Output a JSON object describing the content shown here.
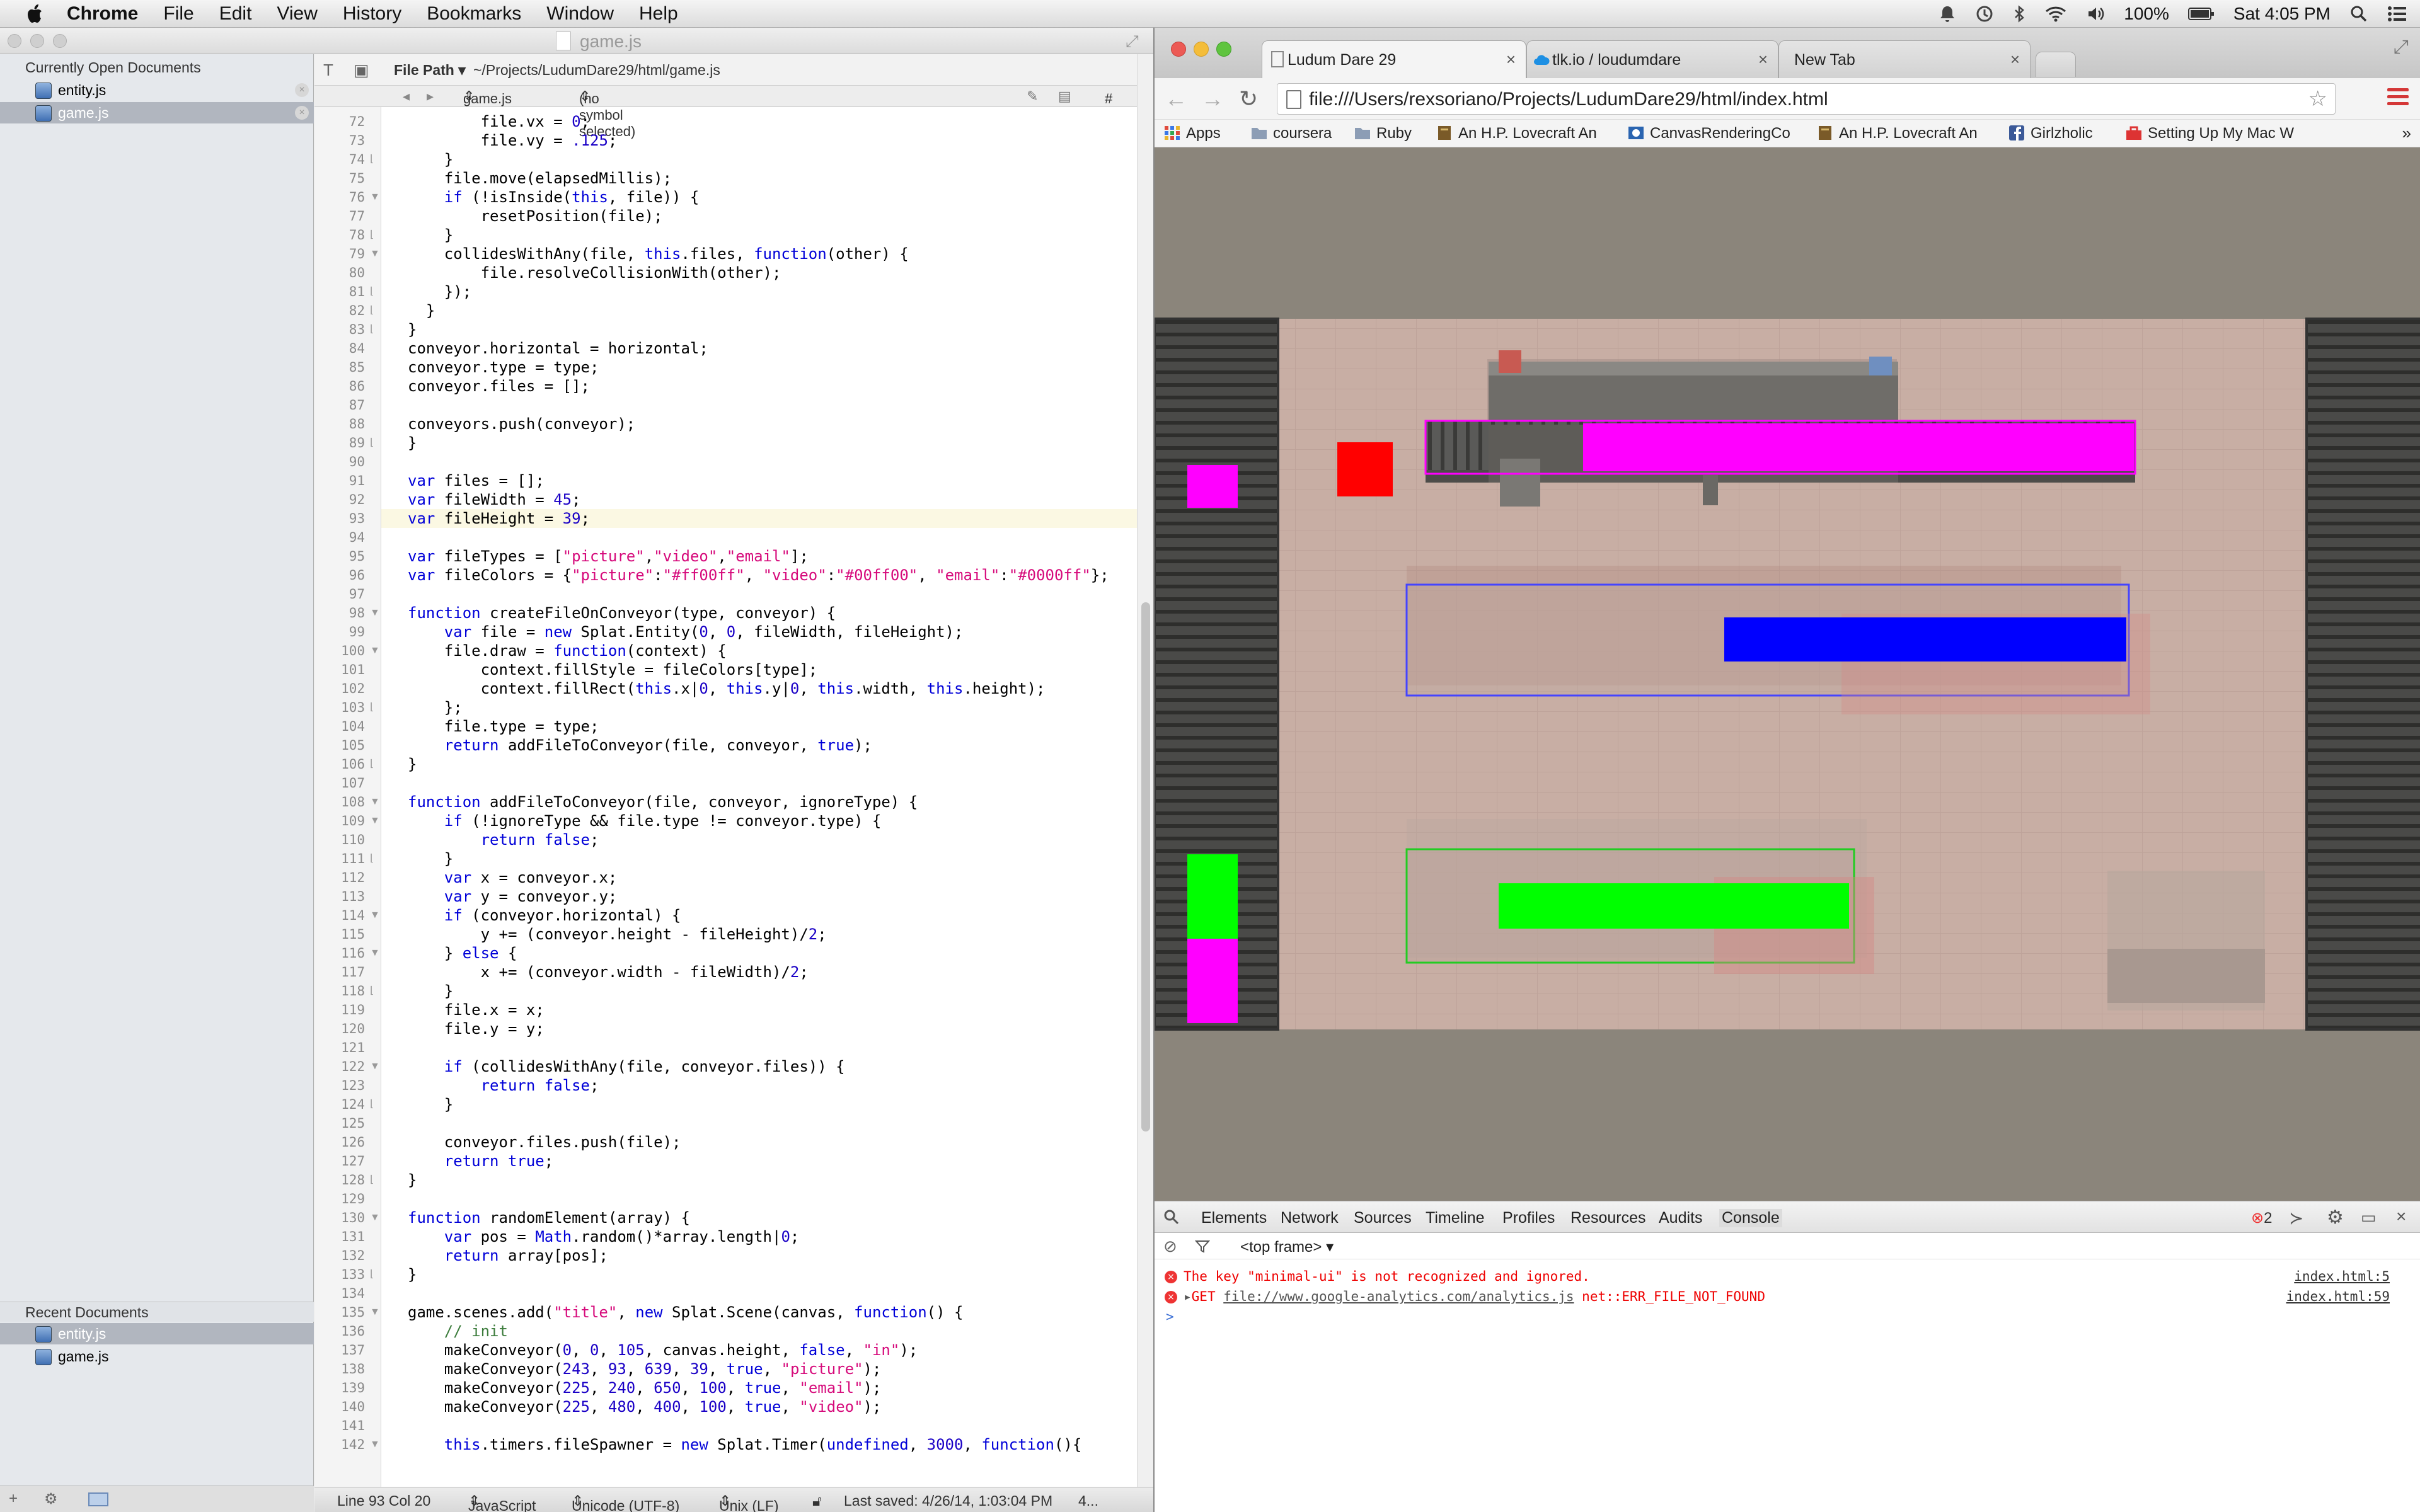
{
  "menubar": {
    "app_name": "Chrome",
    "menus": [
      "File",
      "Edit",
      "View",
      "History",
      "Bookmarks",
      "Window",
      "Help"
    ],
    "battery": "100%",
    "clock": "Sat 4:05 PM"
  },
  "editor": {
    "window_title": "game.js",
    "sidebar": {
      "open_header": "Currently Open Documents",
      "open_docs": [
        "entity.js",
        "game.js"
      ],
      "recent_header": "Recent Documents",
      "recent_docs": [
        "entity.js",
        "game.js"
      ]
    },
    "path_label": "File Path",
    "path_value": "~/Projects/LudumDare29/html/game.js",
    "jump_file": "game.js",
    "jump_symbol": "(no symbol selected)",
    "jump_hash": "#",
    "lines": [
      {
        "n": "72",
        "f": "",
        "h": "        file.vx = <n>0</n>;"
      },
      {
        "n": "73",
        "f": "",
        "h": "        file.vy = <n>.125</n>;"
      },
      {
        "n": "74",
        "f": "-",
        "h": "    }"
      },
      {
        "n": "75",
        "f": "",
        "h": "    file.move(elapsedMillis);"
      },
      {
        "n": "76",
        "f": "v",
        "h": "    <k>if</k> (!isInside(<k>this</k>, file)) {"
      },
      {
        "n": "77",
        "f": "",
        "h": "        resetPosition(file);"
      },
      {
        "n": "78",
        "f": "-",
        "h": "    }"
      },
      {
        "n": "79",
        "f": "v",
        "h": "    collidesWithAny(file, <k>this</k>.files, <k>function</k>(other) {"
      },
      {
        "n": "80",
        "f": "",
        "h": "        file.resolveCollisionWith(other);"
      },
      {
        "n": "81",
        "f": "-",
        "h": "    });"
      },
      {
        "n": "82",
        "f": "-",
        "h": "  }"
      },
      {
        "n": "83",
        "f": "-",
        "h": "}"
      },
      {
        "n": "84",
        "f": "",
        "h": "conveyor.horizontal = horizontal;"
      },
      {
        "n": "85",
        "f": "",
        "h": "conveyor.type = type;"
      },
      {
        "n": "86",
        "f": "",
        "h": "conveyor.files = [];"
      },
      {
        "n": "87",
        "f": "",
        "h": ""
      },
      {
        "n": "88",
        "f": "",
        "h": "conveyors.push(conveyor);"
      },
      {
        "n": "89",
        "f": "-",
        "h": "}"
      },
      {
        "n": "90",
        "f": "",
        "h": ""
      },
      {
        "n": "91",
        "f": "",
        "h": "<k>var</k> files = [];"
      },
      {
        "n": "92",
        "f": "",
        "h": "<k>var</k> fileWidth = <n>45</n>;"
      },
      {
        "n": "93",
        "f": "",
        "h": "<k>var</k> fileHeight = <n>39</n>;"
      },
      {
        "n": "94",
        "f": "",
        "h": ""
      },
      {
        "n": "95",
        "f": "",
        "h": "<k>var</k> fileTypes = [<s>\"picture\"</s>,<s>\"video\"</s>,<s>\"email\"</s>];"
      },
      {
        "n": "96",
        "f": "",
        "h": "<k>var</k> fileColors = {<s>\"picture\"</s>:<s>\"#ff00ff\"</s>, <s>\"video\"</s>:<s>\"#00ff00\"</s>, <s>\"email\"</s>:<s>\"#0000ff\"</s>};"
      },
      {
        "n": "97",
        "f": "",
        "h": ""
      },
      {
        "n": "98",
        "f": "v",
        "h": "<k>function</k> createFileOnConveyor(type, conveyor) {"
      },
      {
        "n": "99",
        "f": "",
        "h": "    <k>var</k> file = <k>new</k> Splat.Entity(<n>0</n>, <n>0</n>, fileWidth, fileHeight);"
      },
      {
        "n": "100",
        "f": "v",
        "h": "    file.draw = <k>function</k>(context) {"
      },
      {
        "n": "101",
        "f": "",
        "h": "        context.fillStyle = fileColors[type];"
      },
      {
        "n": "102",
        "f": "",
        "h": "        context.fillRect(<k>this</k>.x|<n>0</n>, <k>this</k>.y|<n>0</n>, <k>this</k>.width, <k>this</k>.height);"
      },
      {
        "n": "103",
        "f": "-",
        "h": "    };"
      },
      {
        "n": "104",
        "f": "",
        "h": "    file.type = type;"
      },
      {
        "n": "105",
        "f": "",
        "h": "    <k>return</k> addFileToConveyor(file, conveyor, <k>true</k>);"
      },
      {
        "n": "106",
        "f": "-",
        "h": "}"
      },
      {
        "n": "107",
        "f": "",
        "h": ""
      },
      {
        "n": "108",
        "f": "v",
        "h": "<k>function</k> addFileToConveyor(file, conveyor, ignoreType) {"
      },
      {
        "n": "109",
        "f": "v",
        "h": "    <k>if</k> (!ignoreType && file.type != conveyor.type) {"
      },
      {
        "n": "110",
        "f": "",
        "h": "        <k>return</k> <k>false</k>;"
      },
      {
        "n": "111",
        "f": "-",
        "h": "    }"
      },
      {
        "n": "112",
        "f": "",
        "h": "    <k>var</k> x = conveyor.x;"
      },
      {
        "n": "113",
        "f": "",
        "h": "    <k>var</k> y = conveyor.y;"
      },
      {
        "n": "114",
        "f": "v",
        "h": "    <k>if</k> (conveyor.horizontal) {"
      },
      {
        "n": "115",
        "f": "",
        "h": "        y += (conveyor.height - fileHeight)/<n>2</n>;"
      },
      {
        "n": "116",
        "f": "v",
        "h": "    } <k>else</k> {"
      },
      {
        "n": "117",
        "f": "",
        "h": "        x += (conveyor.width - fileWidth)/<n>2</n>;"
      },
      {
        "n": "118",
        "f": "-",
        "h": "    }"
      },
      {
        "n": "119",
        "f": "",
        "h": "    file.x = x;"
      },
      {
        "n": "120",
        "f": "",
        "h": "    file.y = y;"
      },
      {
        "n": "121",
        "f": "",
        "h": ""
      },
      {
        "n": "122",
        "f": "v",
        "h": "    <k>if</k> (collidesWithAny(file, conveyor.files)) {"
      },
      {
        "n": "123",
        "f": "",
        "h": "        <k>return</k> <k>false</k>;"
      },
      {
        "n": "124",
        "f": "-",
        "h": "    }"
      },
      {
        "n": "125",
        "f": "",
        "h": ""
      },
      {
        "n": "126",
        "f": "",
        "h": "    conveyor.files.push(file);"
      },
      {
        "n": "127",
        "f": "",
        "h": "    <k>return</k> <k>true</k>;"
      },
      {
        "n": "128",
        "f": "-",
        "h": "}"
      },
      {
        "n": "129",
        "f": "",
        "h": ""
      },
      {
        "n": "130",
        "f": "v",
        "h": "<k>function</k> randomElement(array) {"
      },
      {
        "n": "131",
        "f": "",
        "h": "    <k>var</k> pos = <k>Math</k>.random()*array.length|<n>0</n>;"
      },
      {
        "n": "132",
        "f": "",
        "h": "    <k>return</k> array[pos];"
      },
      {
        "n": "133",
        "f": "-",
        "h": "}"
      },
      {
        "n": "134",
        "f": "",
        "h": ""
      },
      {
        "n": "135",
        "f": "v",
        "h": "game.scenes.add(<s>\"title\"</s>, <k>new</k> Splat.Scene(canvas, <k>function</k>() {"
      },
      {
        "n": "136",
        "f": "",
        "h": "    <c>// init</c>"
      },
      {
        "n": "137",
        "f": "",
        "h": "    makeConveyor(<n>0</n>, <n>0</n>, <n>105</n>, canvas.height, <k>false</k>, <s>\"in\"</s>);"
      },
      {
        "n": "138",
        "f": "",
        "h": "    makeConveyor(<n>243</n>, <n>93</n>, <n>639</n>, <n>39</n>, <k>true</k>, <s>\"picture\"</s>);"
      },
      {
        "n": "139",
        "f": "",
        "h": "    makeConveyor(<n>225</n>, <n>240</n>, <n>650</n>, <n>100</n>, <k>true</k>, <s>\"email\"</s>);"
      },
      {
        "n": "140",
        "f": "",
        "h": "    makeConveyor(<n>225</n>, <n>480</n>, <n>400</n>, <n>100</n>, <k>true</k>, <s>\"video\"</s>);"
      },
      {
        "n": "141",
        "f": "",
        "h": ""
      },
      {
        "n": "142",
        "f": "v",
        "h": "    <k>this</k>.timers.fileSpawner = <k>new</k> Splat.Timer(<k>undefined</k>, <n>3000</n>, <k>function</k>(){"
      }
    ],
    "highlight_line": "93",
    "status": {
      "position": "Line 93 Col 20",
      "language": "JavaScript",
      "encoding": "Unicode (UTF-8)",
      "line_endings": "Unix (LF)",
      "saved": "Last saved: 4/26/14, 1:03:04 PM",
      "extra": "4..."
    }
  },
  "browser": {
    "tabs": [
      {
        "label": "Ludum Dare 29",
        "active": true
      },
      {
        "label": "tlk.io / loudumdare",
        "active": false
      },
      {
        "label": "New Tab",
        "active": false
      }
    ],
    "url": "file:///Users/rexsoriano/Projects/LudumDare29/html/index.html",
    "bookmarks": [
      "Apps",
      "coursera",
      "Ruby",
      "An H.P. Lovecraft An",
      "CanvasRenderingCo",
      "An H.P. Lovecraft An",
      "Girlzholic",
      "Setting Up My Mac W"
    ],
    "game_colors": {
      "picture": "#ff00ff",
      "video": "#00ff00",
      "email": "#0000ff",
      "red": "#ff0000",
      "floor": "#c9afa5",
      "wall": "#8a847a"
    },
    "devtools": {
      "tabs": [
        "Elements",
        "Network",
        "Sources",
        "Timeline",
        "Profiles",
        "Resources",
        "Audits",
        "Console"
      ],
      "active_tab": "Console",
      "error_count": "2",
      "context": "<top frame>",
      "messages": [
        {
          "text": "The key \"minimal-ui\" is not recognized and ignored.",
          "source": "index.html:5"
        },
        {
          "prefix": "GET ",
          "url": "file://www.google-analytics.com/analytics.js",
          "suffix": " net::ERR_FILE_NOT_FOUND",
          "source": "index.html:59"
        }
      ],
      "prompt": ">"
    }
  }
}
